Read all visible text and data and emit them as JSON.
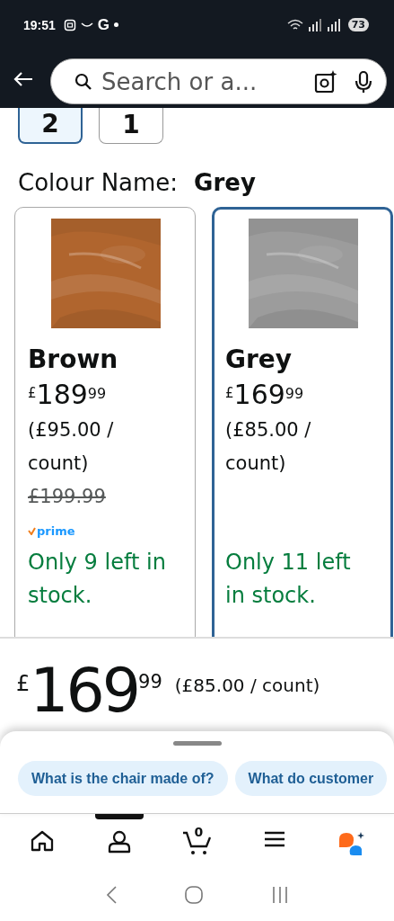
{
  "status_bar": {
    "time": "19:51",
    "notification": "G",
    "battery": "73"
  },
  "search": {
    "placeholder": "Search or a..."
  },
  "pack_sizes": [
    {
      "label": "2",
      "selected": true
    },
    {
      "label": "1",
      "selected": false
    }
  ],
  "colour": {
    "label": "Colour Name:",
    "value": "Grey"
  },
  "variants": [
    {
      "name": "Brown",
      "color": "#b0652e",
      "price": {
        "symbol": "£",
        "whole": "189",
        "fraction": "99"
      },
      "unit_price": "(£95.00 / count)",
      "list_price": "£199.99",
      "prime": true,
      "prime_label": "prime",
      "stock": "Only 9 left in stock.",
      "selected": false
    },
    {
      "name": "Grey",
      "color": "#9c9c9c",
      "price": {
        "symbol": "£",
        "whole": "169",
        "fraction": "99"
      },
      "unit_price": "(£85.00 / count)",
      "prime": false,
      "stock": "Only 11 left in stock.",
      "selected": true
    }
  ],
  "price": {
    "symbol": "£",
    "whole": "169",
    "fraction": "99",
    "unit_price": "(£85.00 / count)"
  },
  "suggestions": [
    "What is the chair made of?",
    "What do customer"
  ],
  "nav": [
    {
      "kind": "home",
      "selected": false
    },
    {
      "kind": "account",
      "selected": true
    },
    {
      "kind": "cart",
      "count": "0",
      "selected": false
    },
    {
      "kind": "menu",
      "selected": false
    },
    {
      "kind": "assistant",
      "selected": false
    }
  ]
}
